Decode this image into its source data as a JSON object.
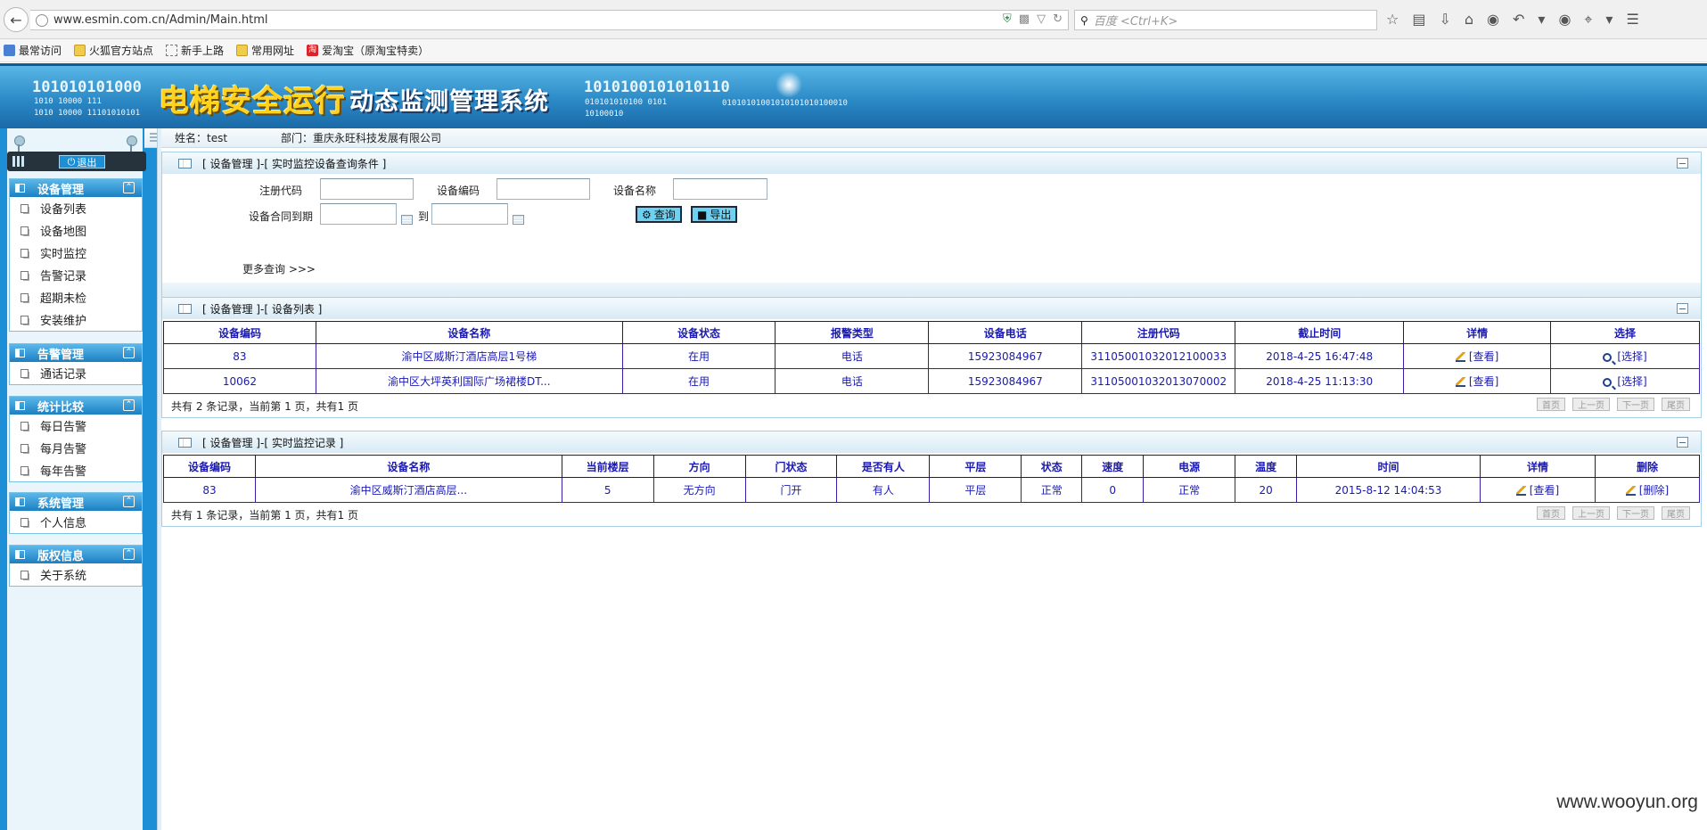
{
  "browser": {
    "url": "www.esmin.com.cn/Admin/Main.html",
    "search_placeholder": "百度 <Ctrl+K>",
    "bookmarks": [
      "最常访问",
      "火狐官方站点",
      "新手上路",
      "常用网址",
      "爱淘宝（原淘宝特卖）"
    ]
  },
  "banner": {
    "title_main": "电梯安全运行",
    "title_sub": "动态监测管理系统",
    "bin_1": "101010101000",
    "bin_2": "1010  10000  111",
    "bin_3": "1010  10000  11101010101",
    "bin_4": "1010100101010110",
    "bin_5": "010101010100     0101",
    "bin_6": "10100010",
    "bin_7": "01010101001010101010100010"
  },
  "sidebar": {
    "logout_label": "退出",
    "groups": [
      {
        "title": "设备管理",
        "items": [
          "设备列表",
          "设备地图",
          "实时监控",
          "告警记录",
          "超期未检",
          "安装维护"
        ]
      },
      {
        "title": "告警管理",
        "items": [
          "通话记录"
        ]
      },
      {
        "title": "统计比较",
        "items": [
          "每日告警",
          "每月告警",
          "每年告警"
        ]
      },
      {
        "title": "系统管理",
        "items": [
          "个人信息"
        ]
      },
      {
        "title": "版权信息",
        "items": [
          "关于系统"
        ]
      }
    ]
  },
  "info_bar": {
    "name": "姓名：test",
    "dept": "部门：重庆永旺科技发展有限公司"
  },
  "query_panel": {
    "title": "[ 设备管理 ]-[ 实时监控设备查询条件 ]",
    "label_reg_code": "注册代码",
    "label_device_code": "设备编码",
    "label_device_name": "设备名称",
    "label_contract": "设备合同到期",
    "label_to": "到",
    "btn_query": "查询",
    "btn_export": "导出",
    "more_query": "更多查询 >>>"
  },
  "device_list": {
    "title": "[ 设备管理 ]-[ 设备列表 ]",
    "headers": [
      "设备编码",
      "设备名称",
      "设备状态",
      "报警类型",
      "设备电话",
      "注册代码",
      "截止时间",
      "详情",
      "选择"
    ],
    "rows": [
      [
        "83",
        "渝中区威斯汀酒店高层1号梯",
        "在用",
        "电话",
        "15923084967",
        "31105001032012100033",
        "2018-4-25 16:47:48",
        "[查看]",
        "[选择]"
      ],
      [
        "10062",
        "渝中区大坪英利国际广场裙楼DT...",
        "在用",
        "电话",
        "15923084967",
        "31105001032013070002",
        "2018-4-25 11:13:30",
        "[查看]",
        "[选择]"
      ]
    ],
    "pager_text": "共有 2 条记录，当前第 1 页，共有1 页",
    "pager_buttons": [
      "首页",
      "上一页",
      "下一页",
      "尾页"
    ]
  },
  "monitor_records": {
    "title": "[ 设备管理 ]-[ 实时监控记录 ]",
    "headers": [
      "设备编码",
      "设备名称",
      "当前楼层",
      "方向",
      "门状态",
      "是否有人",
      "平层",
      "状态",
      "速度",
      "电源",
      "温度",
      "时间",
      "详情",
      "删除"
    ],
    "rows": [
      [
        "83",
        "渝中区威斯汀酒店高层...",
        "5",
        "无方向",
        "门开",
        "有人",
        "平层",
        "正常",
        "0",
        "正常",
        "20",
        "2015-8-12 14:04:53",
        "[查看]",
        "[删除]"
      ]
    ],
    "pager_text": "共有 1 条记录，当前第 1 页，共有1 页",
    "pager_buttons": [
      "首页",
      "上一页",
      "下一页",
      "尾页"
    ]
  },
  "watermark": "www.wooyun.org"
}
